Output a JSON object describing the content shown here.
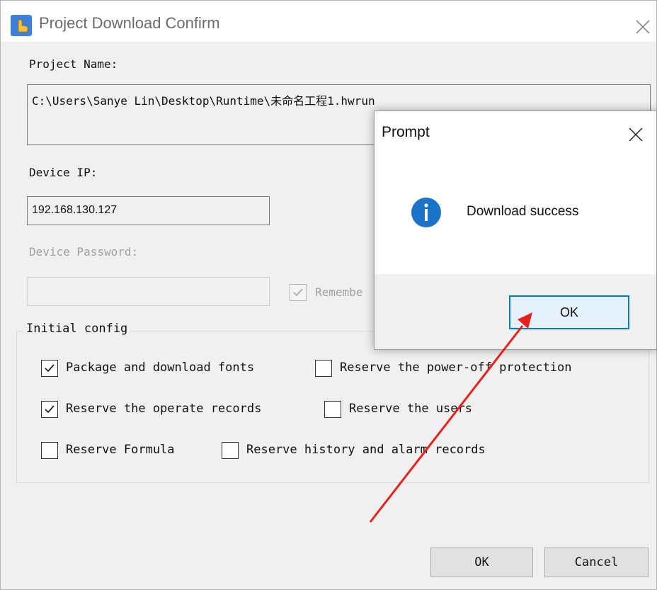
{
  "window": {
    "title": "Project Download Confirm",
    "icon": "hand-pointer-icon"
  },
  "form": {
    "project_name_label": "Project Name:",
    "project_path": "C:\\Users\\Sanye Lin\\Desktop\\Runtime\\未命名工程1.hwrun",
    "device_ip_label": "Device IP:",
    "device_ip": "192.168.130.127",
    "device_password_label": "Device Password:",
    "device_password": "",
    "remember_label": "Remembe",
    "remember_checked": true
  },
  "initial_config": {
    "title": "Initial config",
    "options": [
      {
        "label": "Package and download fonts",
        "checked": true
      },
      {
        "label": "Reserve the power-off protection",
        "checked": false
      },
      {
        "label": "Reserve the operate records",
        "checked": true
      },
      {
        "label": "Reserve the users",
        "checked": false
      },
      {
        "label": "Reserve Formula",
        "checked": false
      },
      {
        "label": "Reserve history and alarm records",
        "checked": false
      }
    ]
  },
  "buttons": {
    "ok": "OK",
    "cancel": "Cancel"
  },
  "prompt": {
    "title": "Prompt",
    "message": "Download success",
    "ok": "OK",
    "icon": "info-icon"
  },
  "colors": {
    "accent": "#0078d7",
    "info_icon": "#1a73c9",
    "annotation_arrow": "#e8201c"
  }
}
